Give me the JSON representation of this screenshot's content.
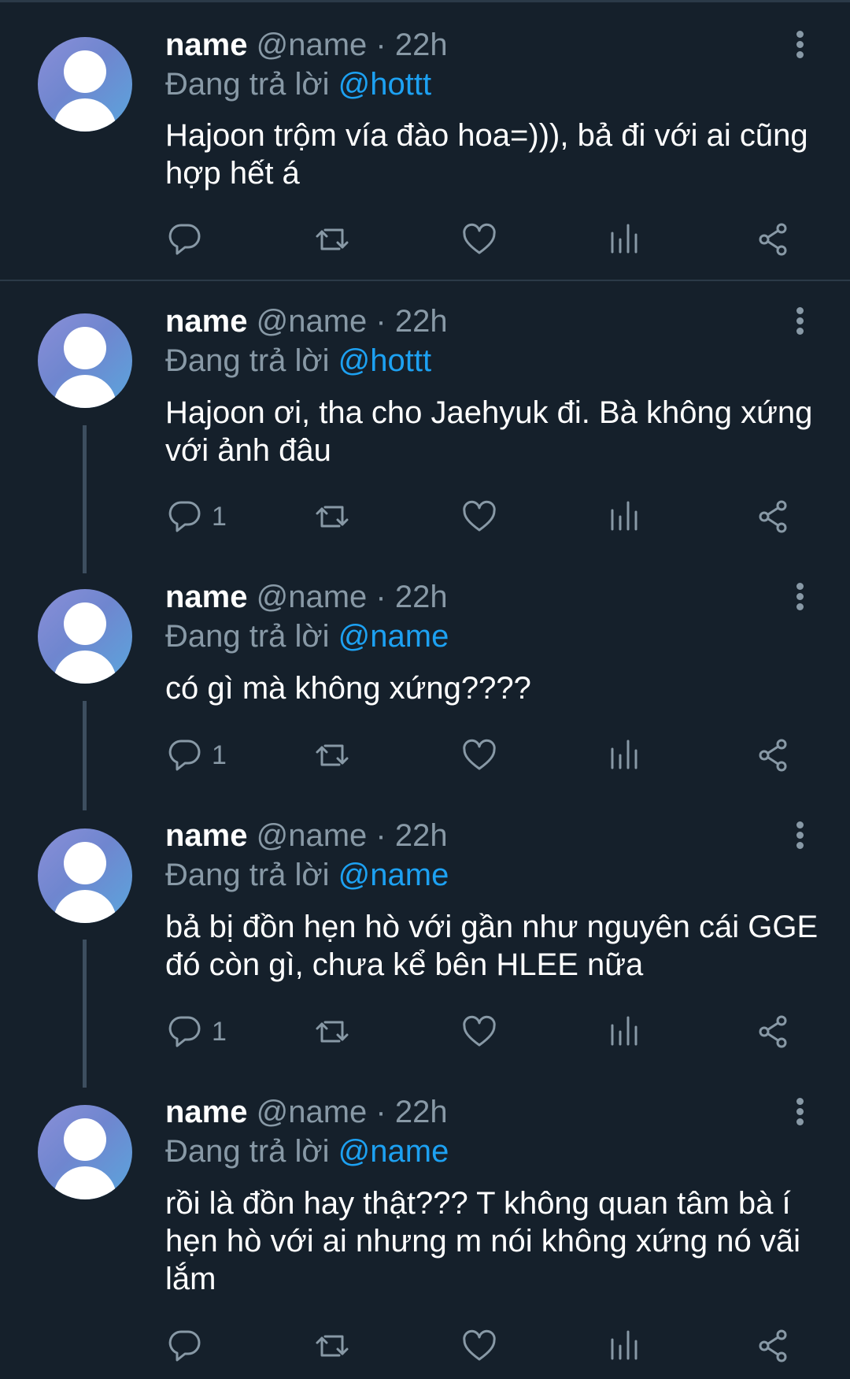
{
  "colors": {
    "background": "#15202b",
    "secondary_text": "#8899a6",
    "mention": "#1da1f2",
    "divider": "#2b3a48"
  },
  "tweets": [
    {
      "name": "name",
      "handle": "@name",
      "separator": "·",
      "time": "22h",
      "replying_prefix": "Đang trả lời",
      "replying_to": "@hottt",
      "text": "Hajoon trộm vía đào hoa=))), bả đi với ai cũng hợp hết á",
      "reply_count": "",
      "icons": [
        "reply-icon",
        "retweet-icon",
        "like-icon",
        "stats-icon",
        "share-icon"
      ]
    },
    {
      "name": "name",
      "handle": "@name",
      "separator": "·",
      "time": "22h",
      "replying_prefix": "Đang trả lời",
      "replying_to": "@hottt",
      "text": "Hajoon ơi, tha cho Jaehyuk đi. Bà không xứng với ảnh đâu",
      "reply_count": "1",
      "icons": [
        "reply-icon",
        "retweet-icon",
        "like-icon",
        "stats-icon",
        "share-icon"
      ]
    },
    {
      "name": "name",
      "handle": "@name",
      "separator": "·",
      "time": "22h",
      "replying_prefix": "Đang trả lời",
      "replying_to": "@name",
      "text": "có gì mà không xứng????",
      "reply_count": "1",
      "icons": [
        "reply-icon",
        "retweet-icon",
        "like-icon",
        "stats-icon",
        "share-icon"
      ]
    },
    {
      "name": "name",
      "handle": "@name",
      "separator": "·",
      "time": "22h",
      "replying_prefix": "Đang trả lời",
      "replying_to": "@name",
      "text": "bả bị đồn hẹn hò với gần như nguyên cái GGE đó còn gì, chưa kể bên HLEE nữa",
      "reply_count": "1",
      "icons": [
        "reply-icon",
        "retweet-icon",
        "like-icon",
        "stats-icon",
        "share-icon"
      ]
    },
    {
      "name": "name",
      "handle": "@name",
      "separator": "·",
      "time": "22h",
      "replying_prefix": "Đang trả lời",
      "replying_to": "@name",
      "text": "rồi là đồn hay thật??? T không quan tâm bà í hẹn hò với ai nhưng m nói không xứng nó vãi lắm",
      "reply_count": "",
      "icons": [
        "reply-icon",
        "retweet-icon",
        "like-icon",
        "stats-icon",
        "share-icon"
      ]
    }
  ]
}
